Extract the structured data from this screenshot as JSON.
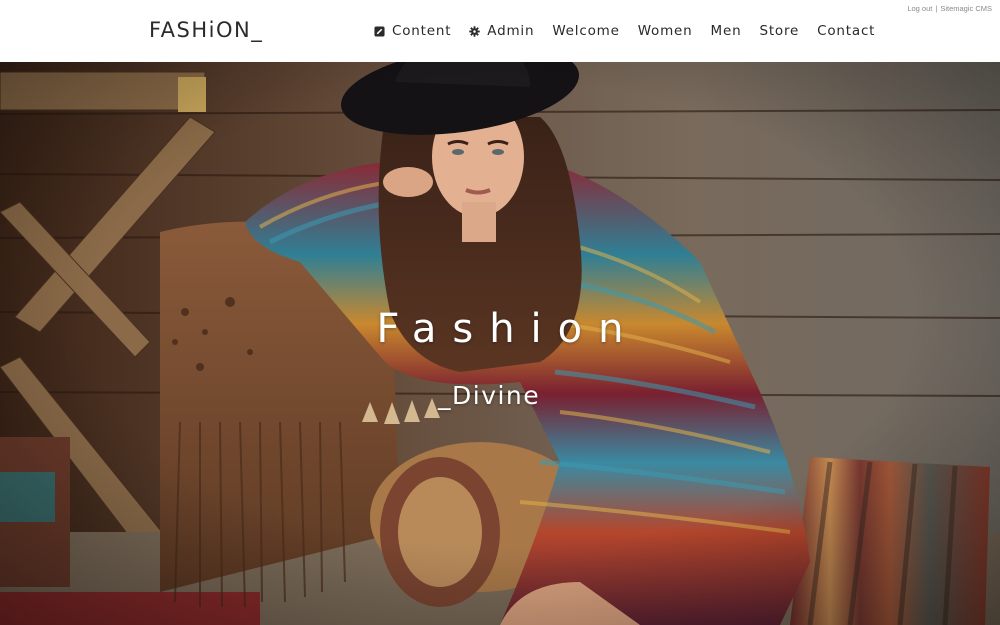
{
  "utility": {
    "logout_label": "Log out",
    "separator": "|",
    "cms_label": "Sitemagic CMS"
  },
  "brand": {
    "logo_text": "FASHiON_"
  },
  "nav": {
    "items": [
      {
        "label": "Content",
        "icon": "edit-icon"
      },
      {
        "label": "Admin",
        "icon": "gear-icon"
      },
      {
        "label": "Welcome"
      },
      {
        "label": "Women"
      },
      {
        "label": "Men"
      },
      {
        "label": "Store"
      },
      {
        "label": "Contact"
      }
    ]
  },
  "hero": {
    "title": "Fashion",
    "subtitle": "_Divine"
  },
  "colors": {
    "header_bg": "#ffffff",
    "text_dark": "#2a2a2a",
    "hero_text": "#ffffff",
    "utility_text": "#8a8a8a"
  }
}
